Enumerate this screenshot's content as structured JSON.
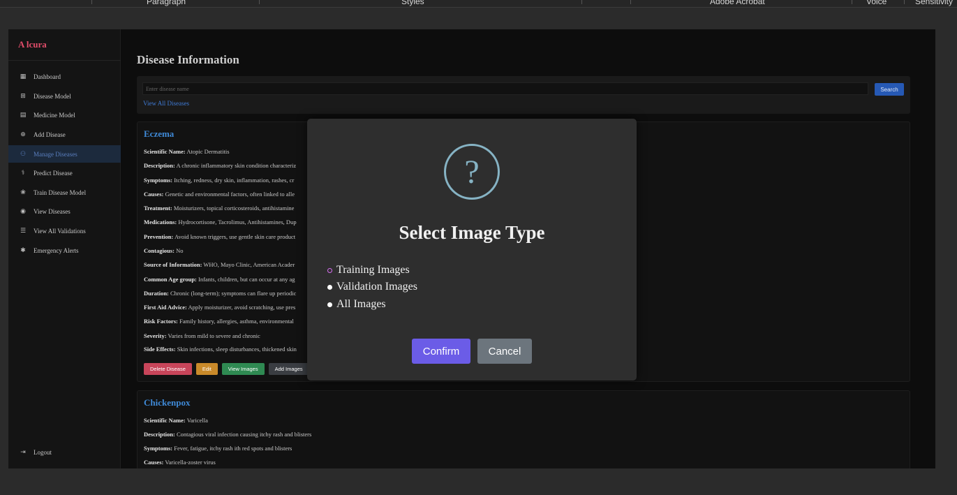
{
  "ribbon": {
    "items": [
      "Paragraph",
      "Styles",
      "Adobe Acrobat",
      "Voice",
      "Sensitivity"
    ]
  },
  "sidebar": {
    "brand": "A lcura",
    "items": [
      {
        "label": "Dashboard",
        "icon": "dashboard-icon"
      },
      {
        "label": "Disease Model",
        "icon": "table-icon"
      },
      {
        "label": "Medicine Model",
        "icon": "medicine-icon"
      },
      {
        "label": "Add Disease",
        "icon": "plus-circle-icon"
      },
      {
        "label": "Manage Diseases",
        "icon": "users-icon"
      },
      {
        "label": "Predict Disease",
        "icon": "stethoscope-icon"
      },
      {
        "label": "Train Disease Model",
        "icon": "brain-icon"
      },
      {
        "label": "View Diseases",
        "icon": "eye-icon"
      },
      {
        "label": "View All Validations",
        "icon": "checklist-icon"
      },
      {
        "label": "Emergency Alerts",
        "icon": "asterisk-icon"
      }
    ],
    "logout": "Logout"
  },
  "main": {
    "title": "Disease Information",
    "search": {
      "placeholder": "Enter disease name",
      "button": "Search",
      "view_all": "View All Diseases"
    },
    "cards": [
      {
        "name": "Eczema",
        "fields": [
          {
            "label": "Scientific Name:",
            "value": " Atopic Dermatitis"
          },
          {
            "label": "Description:",
            "value": " A chronic inflammatory skin condition characteriz"
          },
          {
            "label": "Symptoms:",
            "value": " Itching, redness, dry skin, inflammation, rashes, cr"
          },
          {
            "label": "Causes:",
            "value": " Genetic and environmental factors, often linked to alle"
          },
          {
            "label": "Treatment:",
            "value": " Moisturizers, topical corticosteroids, antihistamine"
          },
          {
            "label": "Medications:",
            "value": " Hydrocortisone, Tacrolimus, Antihistamines, Dup"
          },
          {
            "label": "Prevention:",
            "value": " Avoid known triggers, use gentle skin care product"
          },
          {
            "label": "Contagious:",
            "value": " No"
          },
          {
            "label": "Source of Information:",
            "value": " WHO, Mayo Clinic, American Acader"
          },
          {
            "label": "Common Age group:",
            "value": " Infants, children, but can occur at any ag"
          },
          {
            "label": "Duration:",
            "value": " Chronic (long-term); symptoms can flare up periodic"
          },
          {
            "label": "First Aid Advice:",
            "value": " Apply moisturizer, avoid scratching, use pres"
          },
          {
            "label": "Risk Factors:",
            "value": " Family history, allergies, asthma, environmental"
          },
          {
            "label": "Severity:",
            "value": " Varies from mild to severe and chronic"
          },
          {
            "label": "Side Effects:",
            "value": " Skin infections, sleep disturbances, thickened skin"
          }
        ],
        "actions": [
          "Delete Disease",
          "Edit",
          "View Images",
          "Add Images"
        ]
      },
      {
        "name": "Chickenpox",
        "fields": [
          {
            "label": "Scientific Name:",
            "value": " Varicella"
          },
          {
            "label": "Description:",
            "value": " Contagious viral infection causing itchy rash and blisters"
          },
          {
            "label": "Symptoms:",
            "value": " Fever, fatigue, itchy rash ith red spots and blisters"
          },
          {
            "label": "Causes:",
            "value": " Varicella-zoster virus"
          }
        ]
      }
    ]
  },
  "modal": {
    "icon": "?",
    "title": "Select Image Type",
    "options": [
      "Training Images",
      "Validation Images",
      "All Images"
    ],
    "selected": "Training Images",
    "confirm": "Confirm",
    "cancel": "Cancel"
  },
  "colors": {
    "accent": "#6b5ce7",
    "cancel": "#6c757d",
    "link": "#3f8ad8",
    "brand": "#e14d6a"
  }
}
